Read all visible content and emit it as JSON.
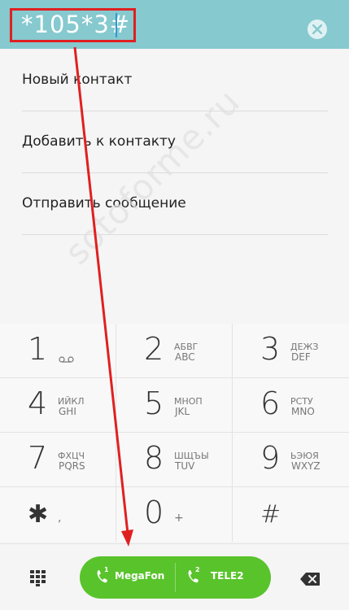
{
  "dialer": {
    "number": "*105*3#"
  },
  "menu": {
    "items": [
      {
        "label": "Новый контакт"
      },
      {
        "label": "Добавить к контакту"
      },
      {
        "label": "Отправить сообщение"
      }
    ]
  },
  "watermark": "sotoforme.ru",
  "keypad": {
    "keys": [
      {
        "digit": "1",
        "letters": "",
        "latin": ""
      },
      {
        "digit": "2",
        "letters": "АБВГ",
        "latin": "ABC"
      },
      {
        "digit": "3",
        "letters": "ДЕЖЗ",
        "latin": "DEF"
      },
      {
        "digit": "4",
        "letters": "ИЙКЛ",
        "latin": "GHI"
      },
      {
        "digit": "5",
        "letters": "МНОП",
        "latin": "JKL"
      },
      {
        "digit": "6",
        "letters": "РСТУ",
        "latin": "MNO"
      },
      {
        "digit": "7",
        "letters": "ФХЦЧ",
        "latin": "PQRS"
      },
      {
        "digit": "8",
        "letters": "ШЩЪЫ",
        "latin": "TUV"
      },
      {
        "digit": "9",
        "letters": "ЬЭЮЯ",
        "latin": "WXYZ"
      },
      {
        "digit": "✱",
        "letters": ",",
        "latin": ""
      },
      {
        "digit": "0",
        "letters": "+",
        "latin": ""
      },
      {
        "digit": "#",
        "letters": "",
        "latin": ""
      }
    ]
  },
  "call": {
    "sim1_label": "MegaFon",
    "sim2_label": "TELE2",
    "sim1_badge": "1",
    "sim2_badge": "2"
  },
  "colors": {
    "header": "#86c9cf",
    "call_button": "#59c32c",
    "annotation": "#e02020"
  },
  "icons": {
    "voicemail": "voicemail-icon",
    "clear": "clear-icon",
    "dialpad": "dialpad-icon",
    "backspace": "backspace-icon",
    "phone": "phone-icon"
  }
}
